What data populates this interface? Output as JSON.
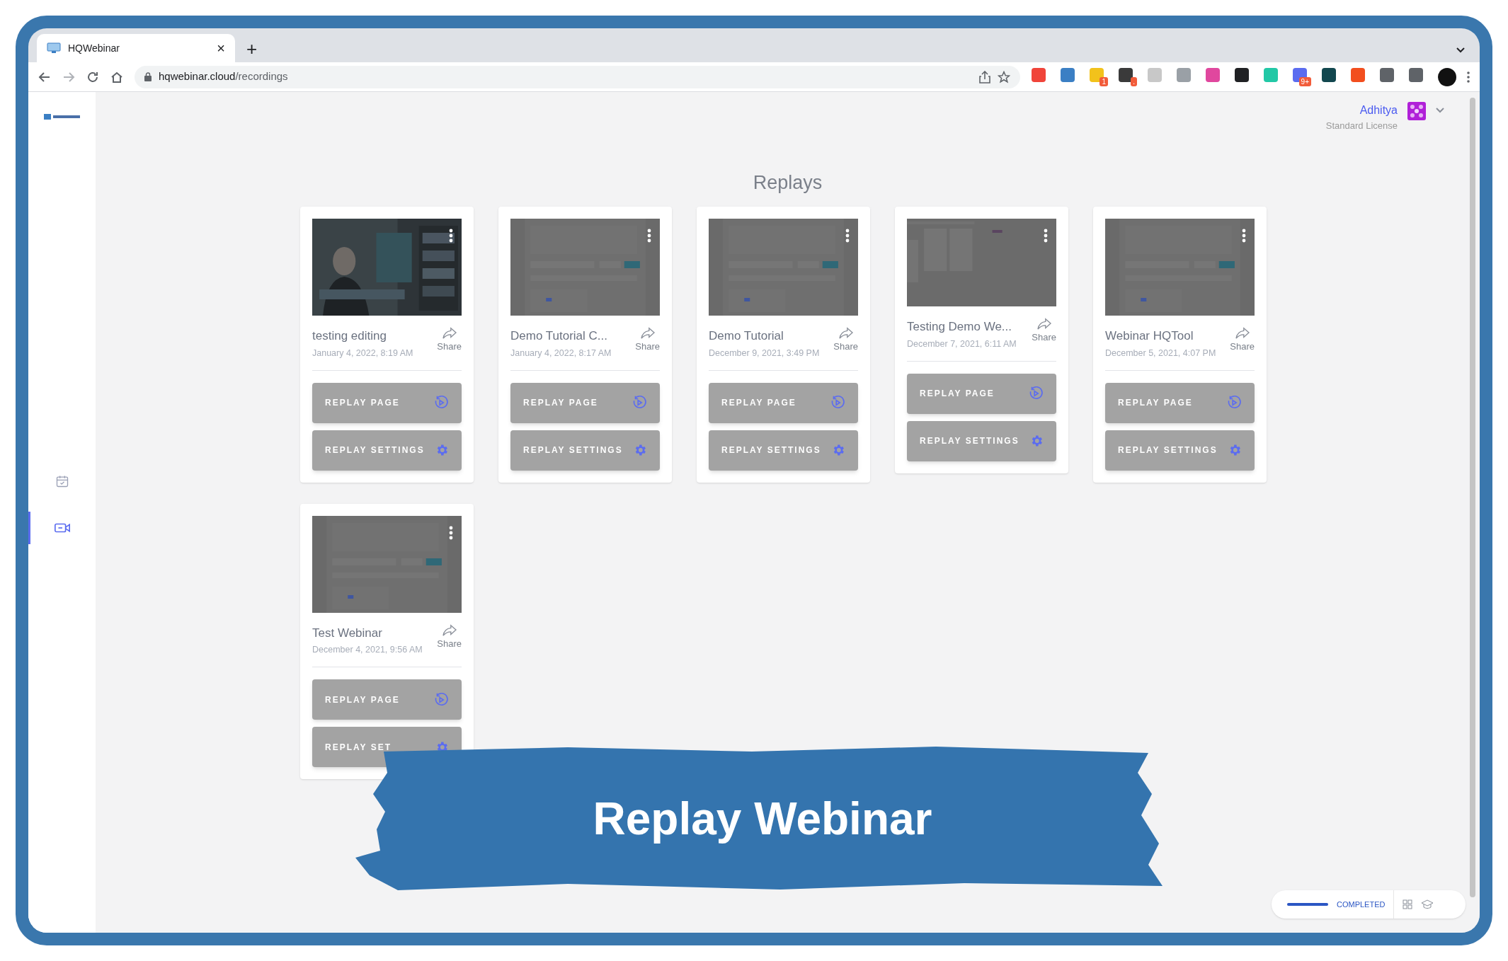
{
  "browser": {
    "tab": {
      "title": "HQWebinar",
      "close": "×",
      "new_tab": "+"
    },
    "url": {
      "host": "hqwebinar.cloud",
      "path": "/recordings"
    },
    "extensions": [
      {
        "color": "#f0443a"
      },
      {
        "color": "#3b7fc4"
      },
      {
        "color": "#f2c21b",
        "badge": "1"
      },
      {
        "color": "#3a3a3a",
        "badge": "."
      },
      {
        "color": "#c8c8c8"
      },
      {
        "color": "#9aa0a6"
      },
      {
        "color": "#e0479e"
      },
      {
        "color": "#202124"
      },
      {
        "color": "#22c8a6"
      },
      {
        "color": "#5b6cf0",
        "badge": "9+"
      },
      {
        "color": "#12474f"
      },
      {
        "color": "#f24e1e"
      },
      {
        "color": "#5f6368"
      },
      {
        "color": "#5f6368"
      }
    ]
  },
  "sidebar": {
    "items": [
      {
        "kind": "calendar",
        "selected": false
      },
      {
        "kind": "video",
        "selected": true
      }
    ]
  },
  "user": {
    "name": "Adhitya",
    "license": "Standard License"
  },
  "page_title": "Replays",
  "cards": [
    {
      "title": "testing editing",
      "date": "January 4, 2022, 8:19 AM",
      "share": "Share",
      "buttons": [
        {
          "kind": "play",
          "label": "REPLAY PAGE"
        },
        {
          "kind": "gear",
          "label": "REPLAY SETTINGS"
        }
      ]
    },
    {
      "kind": "screen",
      "title": "Demo Tutorial C...",
      "date": "January 4, 2022, 8:17 AM",
      "share": "Share",
      "buttons": [
        {
          "kind": "play",
          "label": "REPLAY PAGE"
        },
        {
          "kind": "gear",
          "label": "REPLAY SETTINGS"
        }
      ]
    },
    {
      "kind": "screen",
      "title": "Demo Tutorial",
      "date": "December 9, 2021, 3:49 PM",
      "share": "Share",
      "buttons": [
        {
          "kind": "play",
          "label": "REPLAY PAGE"
        },
        {
          "kind": "gear",
          "label": "REPLAY SETTINGS"
        }
      ]
    },
    {
      "kind": "cards",
      "title": "Testing Demo We...",
      "date": "December 7, 2021, 6:11 AM",
      "share": "Share",
      "buttons": [
        {
          "kind": "play",
          "label": "REPLAY PAGE"
        },
        {
          "kind": "gear",
          "label": "REPLAY SETTINGS"
        }
      ]
    },
    {
      "kind": "screen",
      "title": "Webinar HQTool",
      "date": "December 5, 2021, 4:07 PM",
      "share": "Share",
      "buttons": [
        {
          "kind": "play",
          "label": "REPLAY PAGE"
        },
        {
          "kind": "gear",
          "label": "REPLAY SETTINGS"
        }
      ]
    },
    {
      "kind": "screen",
      "title": "Test Webinar",
      "date": "December 4, 2021, 9:56 AM",
      "share": "Share",
      "buttons": [
        {
          "kind": "play",
          "label": "REPLAY PAGE"
        },
        {
          "kind": "gear",
          "label": "REPLAY SET"
        }
      ]
    }
  ],
  "banner": {
    "text": "Replay Webinar"
  },
  "progress": {
    "level": 1,
    "label": "COMPLETED"
  }
}
